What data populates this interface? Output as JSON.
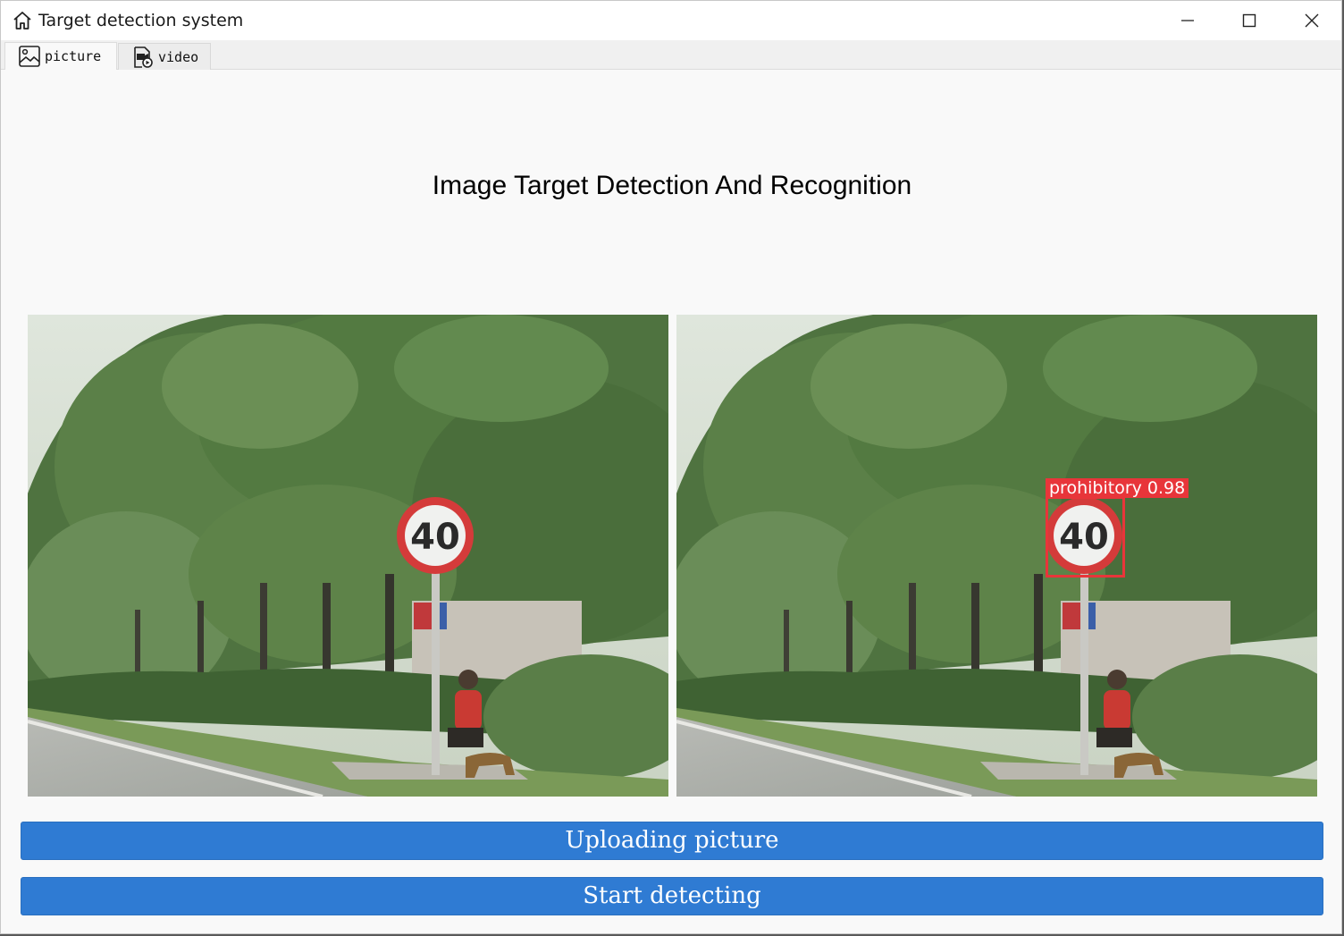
{
  "window": {
    "title": "Target detection system",
    "icon": "home-icon",
    "controls": [
      "minimize-icon",
      "maximize-icon",
      "close-icon"
    ]
  },
  "tabs": [
    {
      "label": "picture",
      "icon": "image-icon",
      "active": true
    },
    {
      "label": "video",
      "icon": "video-file-icon",
      "active": false
    }
  ],
  "main": {
    "heading": "Image Target Detection And Recognition",
    "original_image": {
      "description_icon": "source-photo"
    },
    "result_image": {
      "detection": {
        "label": "prohibitory",
        "confidence": "0.98",
        "display": "prohibitory  0.98"
      }
    },
    "sign_text": "40"
  },
  "buttons": {
    "upload": "Uploading picture",
    "detect": "Start detecting"
  },
  "colors": {
    "button_bg": "#2f7bd3",
    "detection_box": "#e8353a",
    "window_bg": "#f9f9f9"
  }
}
